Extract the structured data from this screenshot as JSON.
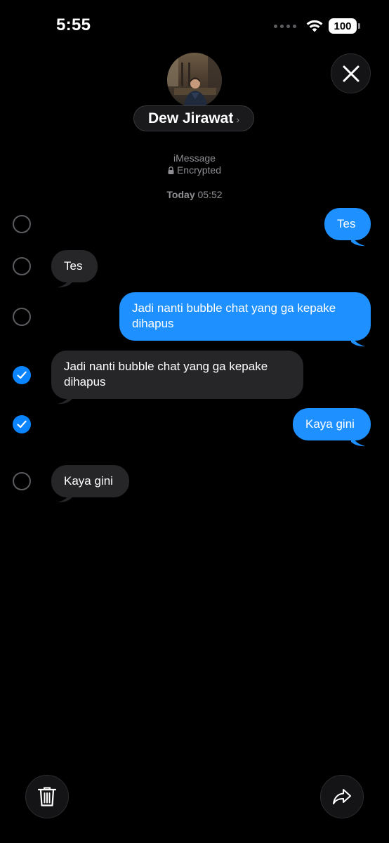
{
  "status_bar": {
    "time": "5:55",
    "battery": "100"
  },
  "header": {
    "contact_name": "Dew Jirawat",
    "chevron": "›",
    "service": "iMessage",
    "encryption": "Encrypted",
    "date_day": "Today",
    "date_time": "05:52"
  },
  "messages": [
    {
      "direction": "sent",
      "text": "Tes",
      "selected": false
    },
    {
      "direction": "received",
      "text": "Tes",
      "selected": false
    },
    {
      "direction": "sent",
      "text": "Jadi nanti bubble chat yang ga kepake dihapus",
      "selected": false
    },
    {
      "direction": "received",
      "text": "Jadi nanti bubble chat yang ga kepake dihapus",
      "selected": true
    },
    {
      "direction": "sent",
      "text": "Kaya gini",
      "selected": true
    },
    {
      "direction": "received",
      "text": "Kaya gini",
      "selected": false
    }
  ],
  "icons": {
    "close": "close-icon",
    "wifi": "wifi-icon",
    "lock": "lock-icon",
    "checkmark": "checkmark-icon",
    "trash": "trash-icon",
    "share": "share-icon"
  },
  "colors": {
    "background": "#000000",
    "sent_bubble": "#1e90ff",
    "received_bubble": "#262629",
    "selection_accent": "#0a84ff",
    "secondary_text": "#8e8e93"
  }
}
